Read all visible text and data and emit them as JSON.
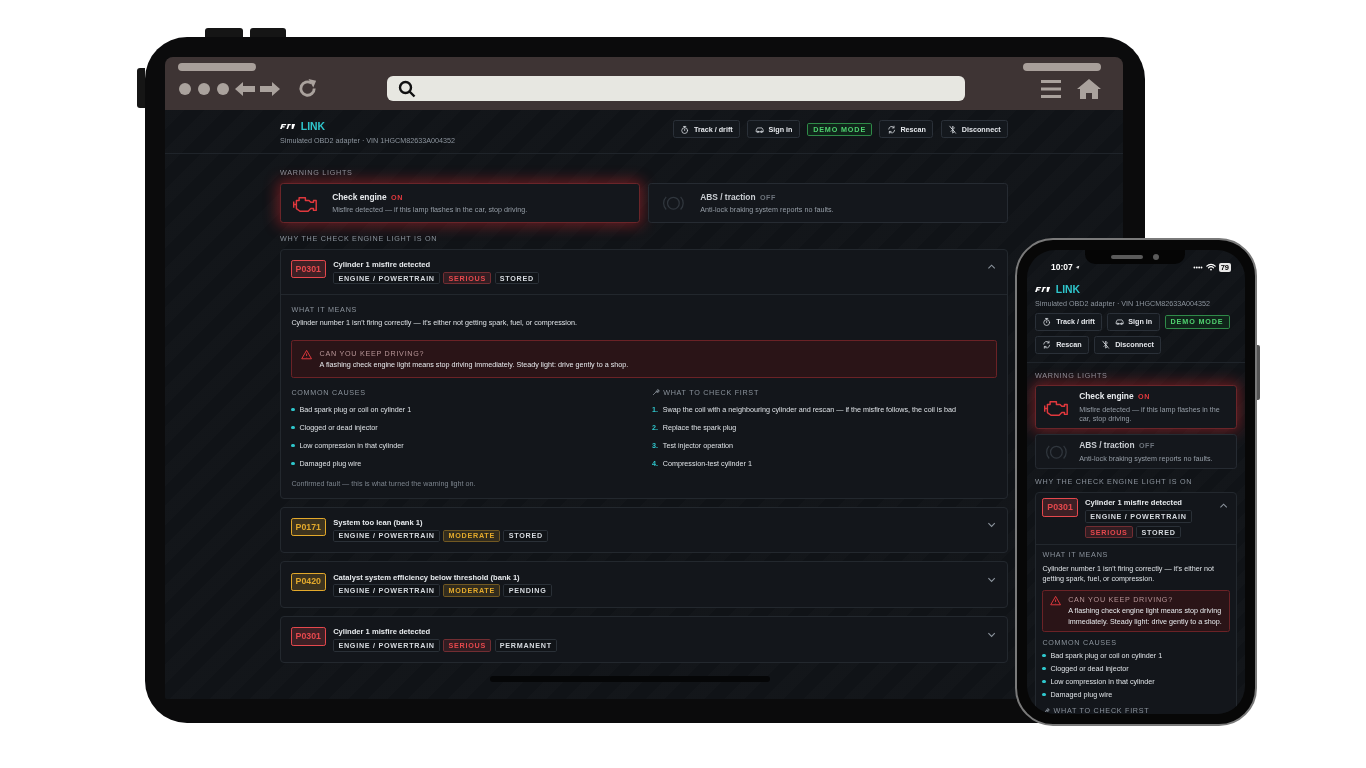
{
  "tablet": {
    "app": {
      "brand": "LINK",
      "subtitle": "Simulated OBD2 adapter · VIN 1HGCM82633A004352",
      "actions": [
        {
          "kind": "track",
          "label": "Track / drift"
        },
        {
          "kind": "account",
          "label": "Sign in"
        },
        {
          "kind": "mode",
          "label": "DEMO MODE"
        },
        {
          "kind": "rescan",
          "label": "Rescan"
        },
        {
          "kind": "disconnect",
          "label": "Disconnect"
        }
      ],
      "warning_title": "WARNING LIGHTS",
      "warning_lights": [
        {
          "kind": "engine",
          "name": "Check engine",
          "status": "ON",
          "on": true,
          "description": "Misfire detected — if this lamp flashes in the car, stop driving."
        },
        {
          "kind": "abs",
          "name": "ABS / traction",
          "status": "OFF",
          "on": false,
          "description": "Anti-lock braking system reports no faults."
        }
      ],
      "codes_title": "WHY THE CHECK ENGINE LIGHT IS ON",
      "codes": [
        {
          "code": "P0301",
          "title": "Cylinder 1 misfire detected",
          "color": "#e5484d",
          "expanded": true,
          "tags": [
            {
              "kind": "category",
              "label": "ENGINE / POWERTRAIN"
            },
            {
              "kind": "severity",
              "label": "SERIOUS"
            },
            {
              "kind": "status",
              "label": "STORED"
            }
          ],
          "details": {
            "meaning_title": "WHAT IT MEANS",
            "meaning": "Cylinder number 1 isn't firing correctly — it's either not getting spark, fuel, or compression.",
            "alert": {
              "title": "CAN YOU KEEP DRIVING?",
              "text": "A flashing check engine light means stop driving immediately. Steady light: drive gently to a shop."
            },
            "causes_title": "COMMON CAUSES",
            "causes": [
              "Bad spark plug or coil on cylinder 1",
              "Clogged or dead injector",
              "Low compression in that cylinder",
              "Damaged plug wire"
            ],
            "checks_title": "WHAT TO CHECK FIRST",
            "checks": [
              {
                "number": "1.",
                "text": "Swap the coil with a neighbouring cylinder and rescan — if the misfire follows, the coil is bad"
              },
              {
                "number": "2.",
                "text": "Replace the spark plug"
              },
              {
                "number": "3.",
                "text": "Test injector operation"
              },
              {
                "number": "4.",
                "text": "Compression-test cylinder 1"
              }
            ],
            "footnote": "Confirmed fault — this is what turned the warning light on."
          }
        },
        {
          "code": "P0171",
          "title": "System too lean (bank 1)",
          "color": "#e3a92b",
          "expanded": false,
          "tags": [
            {
              "kind": "category",
              "label": "ENGINE / POWERTRAIN"
            },
            {
              "kind": "severity",
              "label": "MODERATE"
            },
            {
              "kind": "status",
              "label": "STORED"
            }
          ]
        },
        {
          "code": "P0420",
          "title": "Catalyst system efficiency below threshold (bank 1)",
          "color": "#e3a92b",
          "expanded": false,
          "tags": [
            {
              "kind": "category",
              "label": "ENGINE / POWERTRAIN"
            },
            {
              "kind": "severity",
              "label": "MODERATE"
            },
            {
              "kind": "status",
              "label": "PENDING"
            }
          ]
        },
        {
          "code": "P0301",
          "title": "Cylinder 1 misfire detected",
          "color": "#e5484d",
          "expanded": false,
          "tags": [
            {
              "kind": "category",
              "label": "ENGINE / POWERTRAIN"
            },
            {
              "kind": "severity",
              "label": "SERIOUS"
            },
            {
              "kind": "status",
              "label": "PERMANENT"
            }
          ]
        }
      ]
    }
  },
  "phone": {
    "status_bar": {
      "time": "10:07",
      "battery": "79"
    },
    "app": {
      "brand": "LINK",
      "subtitle": "Simulated OBD2 adapter · VIN 1HGCM82633A004352",
      "actions": [
        {
          "kind": "track",
          "label": "Track / drift"
        },
        {
          "kind": "account",
          "label": "Sign in"
        },
        {
          "kind": "mode",
          "label": "DEMO MODE"
        },
        {
          "kind": "rescan",
          "label": "Rescan"
        },
        {
          "kind": "disconnect",
          "label": "Disconnect"
        }
      ],
      "warning_title": "WARNING LIGHTS",
      "warning_lights": [
        {
          "kind": "engine",
          "name": "Check engine",
          "status": "ON",
          "on": true,
          "description": "Misfire detected — if this lamp flashes in the car, stop driving."
        },
        {
          "kind": "abs",
          "name": "ABS / traction",
          "status": "OFF",
          "on": false,
          "description": "Anti-lock braking system reports no faults."
        }
      ],
      "codes_title": "WHY THE CHECK ENGINE LIGHT IS ON",
      "codes": [
        {
          "code": "P0301",
          "title": "Cylinder 1 misfire detected",
          "color": "#e5484d",
          "expanded": true,
          "tags": [
            {
              "kind": "category",
              "label": "ENGINE / POWERTRAIN"
            },
            {
              "kind": "severity",
              "label": "SERIOUS"
            },
            {
              "kind": "status",
              "label": "STORED"
            }
          ],
          "details": {
            "meaning_title": "WHAT IT MEANS",
            "meaning": "Cylinder number 1 isn't firing correctly — it's either not getting spark, fuel, or compression.",
            "alert": {
              "title": "CAN YOU KEEP DRIVING?",
              "text": "A flashing check engine light means stop driving immediately. Steady light: drive gently to a shop."
            },
            "causes_title": "COMMON CAUSES",
            "causes": [
              "Bad spark plug or coil on cylinder 1",
              "Clogged or dead injector",
              "Low compression in that cylinder",
              "Damaged plug wire"
            ],
            "checks_title": "WHAT TO CHECK FIRST"
          }
        }
      ]
    }
  }
}
